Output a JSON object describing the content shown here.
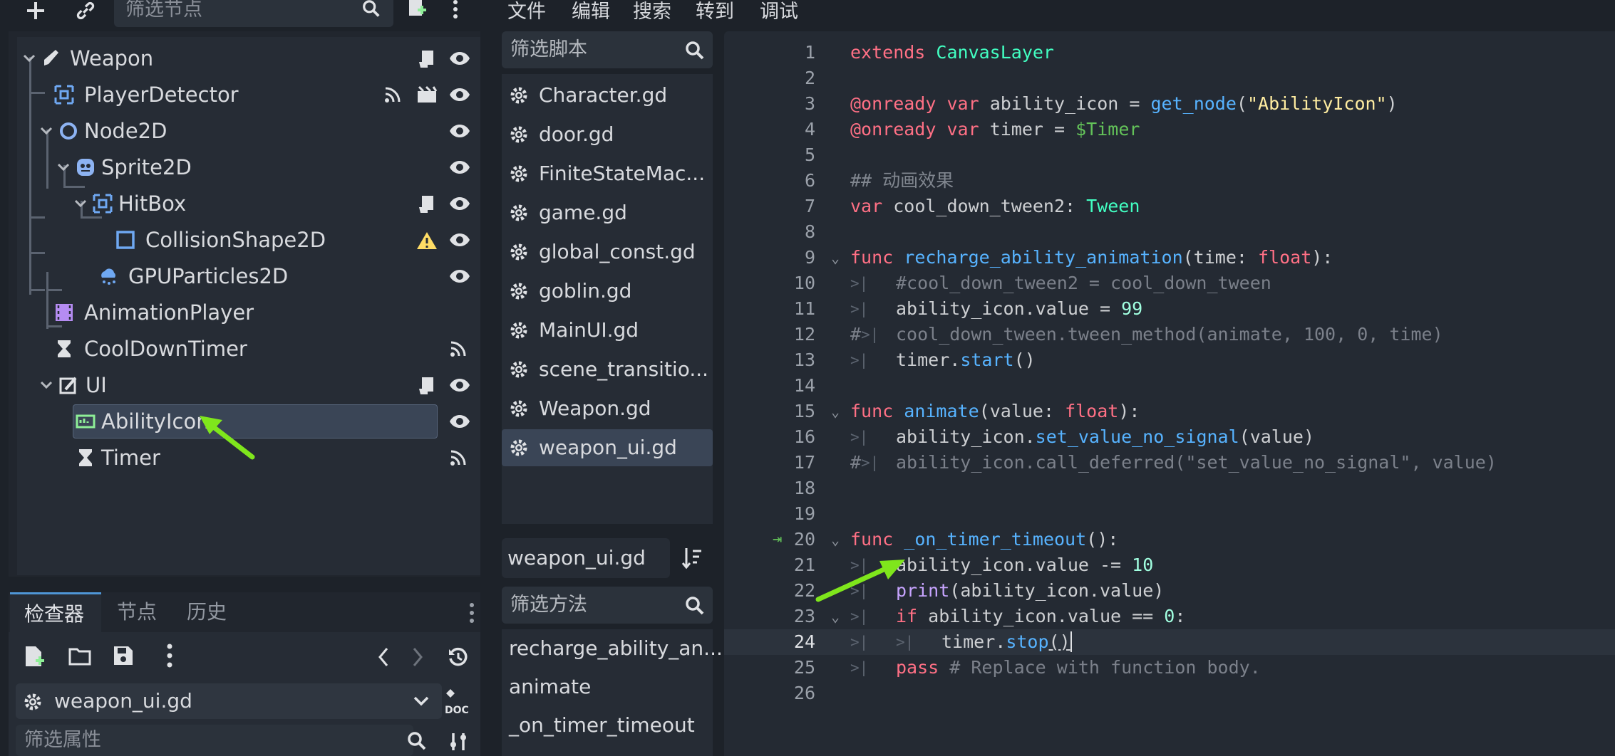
{
  "scene_dock": {
    "filter_placeholder": "筛选节点",
    "nodes": [
      {
        "label": "Weapon",
        "icon": "weapon-node-icon"
      },
      {
        "label": "PlayerDetector",
        "icon": "area-node-icon"
      },
      {
        "label": "Node2D",
        "icon": "node2d-icon"
      },
      {
        "label": "Sprite2D",
        "icon": "sprite2d-icon"
      },
      {
        "label": "HitBox",
        "icon": "area-node-icon"
      },
      {
        "label": "CollisionShape2D",
        "icon": "collision-shape-icon"
      },
      {
        "label": "GPUParticles2D",
        "icon": "particles-icon"
      },
      {
        "label": "AnimationPlayer",
        "icon": "animation-player-icon"
      },
      {
        "label": "CoolDownTimer",
        "icon": "timer-icon"
      },
      {
        "label": "UI",
        "icon": "canvas-layer-icon"
      },
      {
        "label": "AbilityIcon",
        "icon": "progress-bar-icon"
      },
      {
        "label": "Timer",
        "icon": "timer-icon"
      }
    ],
    "selected_node": "AbilityIcon"
  },
  "inspector": {
    "tabs": [
      "检查器",
      "节点",
      "历史"
    ],
    "active_tab": "检查器",
    "resource": "weapon_ui.gd",
    "filter_placeholder": "筛选属性"
  },
  "menu": [
    "文件",
    "编辑",
    "搜索",
    "转到",
    "调试"
  ],
  "script_list": {
    "filter_placeholder": "筛选脚本",
    "items": [
      "Character.gd",
      "door.gd",
      "FiniteStateMac...",
      "game.gd",
      "global_const.gd",
      "goblin.gd",
      "MainUI.gd",
      "scene_transitio...",
      "Weapon.gd",
      "weapon_ui.gd"
    ],
    "selected": "weapon_ui.gd",
    "current_file": "weapon_ui.gd",
    "method_filter_placeholder": "筛选方法",
    "methods": [
      "recharge_ability_an...",
      "animate",
      "_on_timer_timeout"
    ]
  },
  "editor": {
    "line_numbers": [
      "1",
      "2",
      "3",
      "4",
      "5",
      "6",
      "7",
      "8",
      "9",
      "10",
      "11",
      "12",
      "13",
      "14",
      "15",
      "16",
      "17",
      "18",
      "19",
      "20",
      "21",
      "22",
      "23",
      "24",
      "25",
      "26"
    ],
    "current_line": 24
  },
  "colors": {
    "accent": "#4f96d6",
    "selection": "#3a4556",
    "warning": "#ffdd65",
    "arrow": "#7fe61c",
    "keyword": "#ff7085",
    "type": "#42ffc2",
    "function": "#57b3ff",
    "string": "#ffeda1"
  }
}
